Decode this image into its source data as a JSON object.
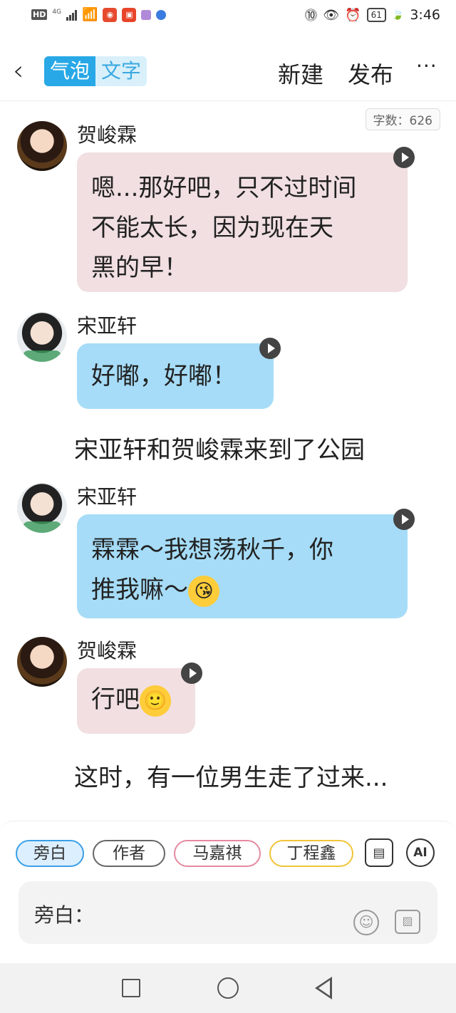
{
  "status_bar": {
    "hd": "HD",
    "network": "4G",
    "battery": "61",
    "time": "3:46"
  },
  "header": {
    "mode_bubble": "气泡",
    "mode_text": "文字",
    "new_label": "新建",
    "publish_label": "发布",
    "more_label": "···"
  },
  "word_count": "字数：626",
  "messages": [
    {
      "speaker": "贺峻霖",
      "text_lines": [
        "嗯...那好吧，只不过时间",
        "不能太长，因为现在天",
        "黑的早！"
      ]
    },
    {
      "speaker": "宋亚轩",
      "text_lines": [
        "好嘟，好嘟！"
      ]
    },
    {
      "narration": "宋亚轩和贺峻霖来到了公园"
    },
    {
      "speaker": "宋亚轩",
      "text_lines": [
        "霖霖～我想荡秋千，你",
        "推我嘛～"
      ],
      "emoji": "😘"
    },
    {
      "speaker": "贺峻霖",
      "text_lines": [
        "行吧"
      ],
      "emoji": "🙂"
    },
    {
      "narration": "这时，有一位男生走了过来..."
    }
  ],
  "composer": {
    "roles": [
      "旁白",
      "作者",
      "马嘉祺",
      "丁程鑫"
    ],
    "card_icon": "card-icon",
    "ai_label": "AI",
    "input_label": "旁白："
  },
  "colors": {
    "accent": "#28a8e6",
    "bubble_pink": "#f1dfe1",
    "bubble_blue": "#a6dcf7"
  }
}
